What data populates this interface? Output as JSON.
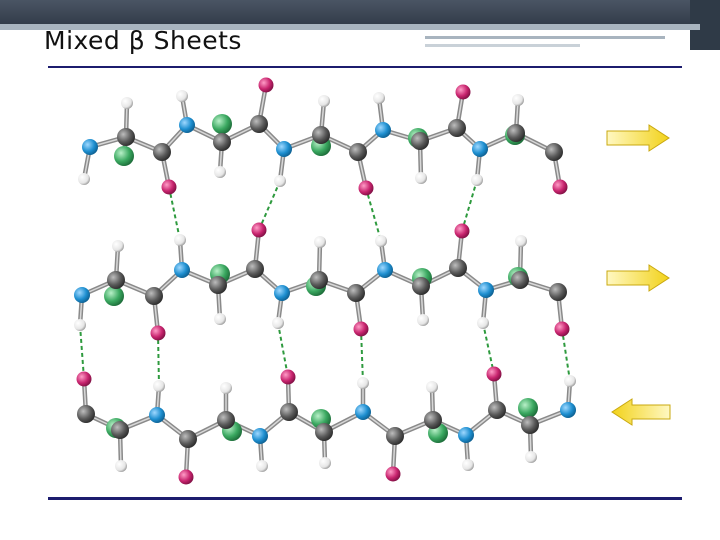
{
  "slide": {
    "title": "Mixed β Sheets"
  },
  "figure": {
    "strand_arrows": [
      {
        "direction": "right"
      },
      {
        "direction": "right"
      },
      {
        "direction": "left"
      }
    ],
    "colors": {
      "carbon": "#5a5a5a",
      "nitrogen": "#1e8fd0",
      "oxygen": "#c8246e",
      "hydrogen": "#e6e6e6",
      "side_chain": "#3aa860",
      "h_bond": "#2e9a3e",
      "arrow": "#f2d21a",
      "rule": "#1c1c6e"
    }
  }
}
